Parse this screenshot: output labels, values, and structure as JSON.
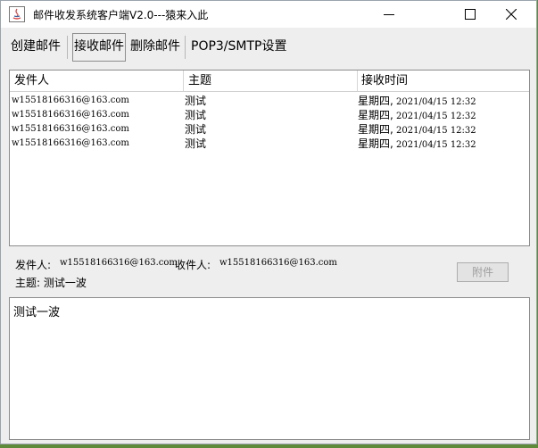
{
  "window": {
    "title": "邮件收发系统客户端V2.0---猿来入此"
  },
  "toolbar": {
    "create": "创建邮件",
    "receive": "接收邮件",
    "delete": "删除邮件",
    "settings": "POP3/SMTP设置"
  },
  "table": {
    "columns": [
      "发件人",
      "主题",
      "接收时间"
    ],
    "rows": [
      {
        "sender": "w15518166316@163.com",
        "subject": "测试",
        "weekday": "星期四,",
        "datetime": " 2021/04/15 12:32"
      },
      {
        "sender": "w15518166316@163.com",
        "subject": "测试",
        "weekday": "星期四,",
        "datetime": " 2021/04/15 12:32"
      },
      {
        "sender": "w15518166316@163.com",
        "subject": "测试",
        "weekday": "星期四,",
        "datetime": " 2021/04/15 12:32"
      },
      {
        "sender": "w15518166316@163.com",
        "subject": "测试",
        "weekday": "星期四,",
        "datetime": " 2021/04/15 12:32"
      }
    ]
  },
  "detail": {
    "from_label": "发件人:",
    "from_value": "w15518166316@163.com",
    "to_label": "收件人:",
    "to_value": "w15518166316@163.com",
    "subject_label": "主题: 测试一波",
    "attachment_button": "附件",
    "body": "测试一波"
  }
}
